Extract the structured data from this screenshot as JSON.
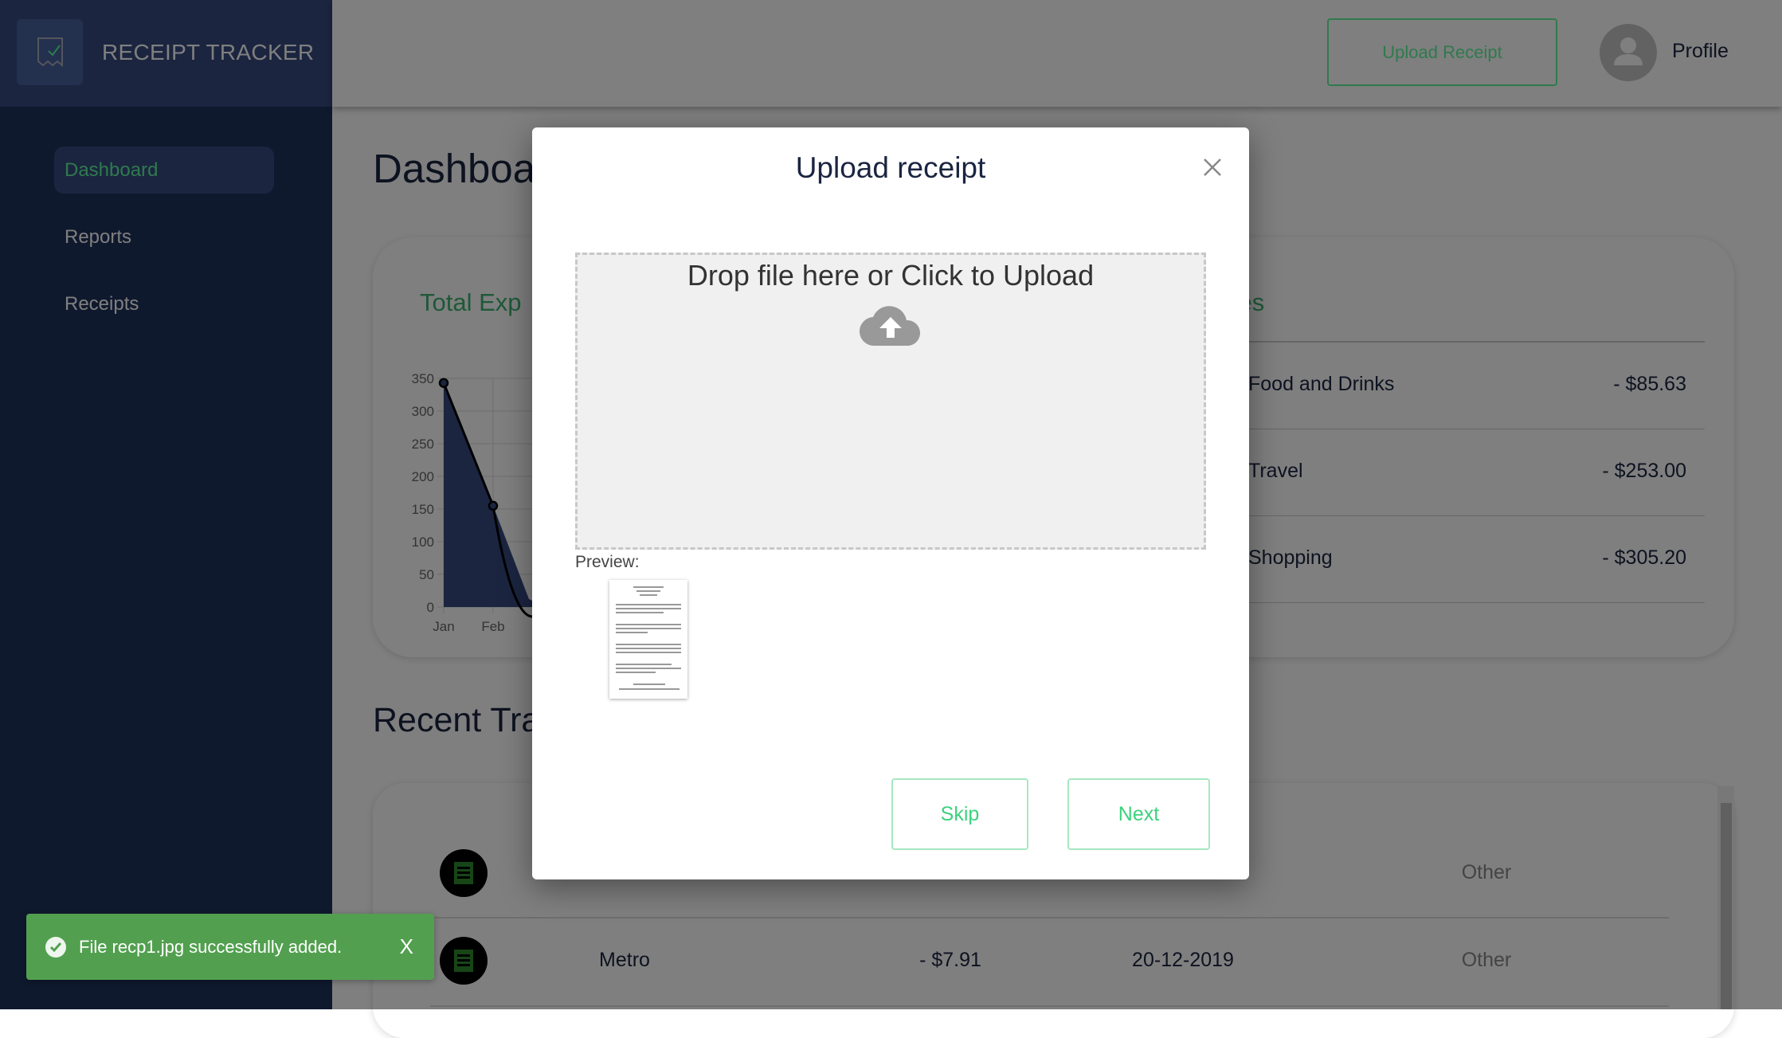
{
  "app": {
    "title": "RECEIPT TRACKER",
    "logo_icon": "receipt-check-icon"
  },
  "sidebar": {
    "items": [
      {
        "label": "Dashboard",
        "active": true
      },
      {
        "label": "Reports"
      },
      {
        "label": "Receipts"
      }
    ]
  },
  "header": {
    "upload_label": "Upload Receipt",
    "profile_label": "Profile",
    "avatar_icon": "user-icon"
  },
  "main": {
    "title": "Dashboard",
    "total_card_title": "Total Exp",
    "categories_title": "ories",
    "categories": [
      {
        "name": "Food and Drinks",
        "amount": "- $85.63"
      },
      {
        "name": "Travel",
        "amount": "- $253.00"
      },
      {
        "name": "Shopping",
        "amount": "- $305.20"
      }
    ],
    "recent_title": "Recent Tra",
    "transactions": [
      {
        "name": "",
        "amount": "",
        "date": "",
        "category": "Other"
      },
      {
        "name": "Metro",
        "amount": "- $7.91",
        "date": "20-12-2019",
        "category": "Other"
      }
    ]
  },
  "chart_data": {
    "type": "area",
    "categories": [
      "Jan",
      "Feb"
    ],
    "values": [
      343,
      155
    ],
    "yticks": [
      "0",
      "50",
      "100",
      "150",
      "200",
      "250",
      "300",
      "350"
    ],
    "ylim": [
      0,
      350
    ],
    "grid": true,
    "fill_color": "#364a80",
    "line_color": "#000000"
  },
  "modal": {
    "title": "Upload receipt",
    "drop_text": "Drop file here or Click to Upload",
    "preview_label": "Preview:",
    "skip_label": "Skip",
    "next_label": "Next"
  },
  "toast": {
    "message": "File recp1.jpg successfully added.",
    "close": "X",
    "color": "#52a04f"
  },
  "colors": {
    "accent": "#3cb371",
    "navy": "#1b2540"
  }
}
